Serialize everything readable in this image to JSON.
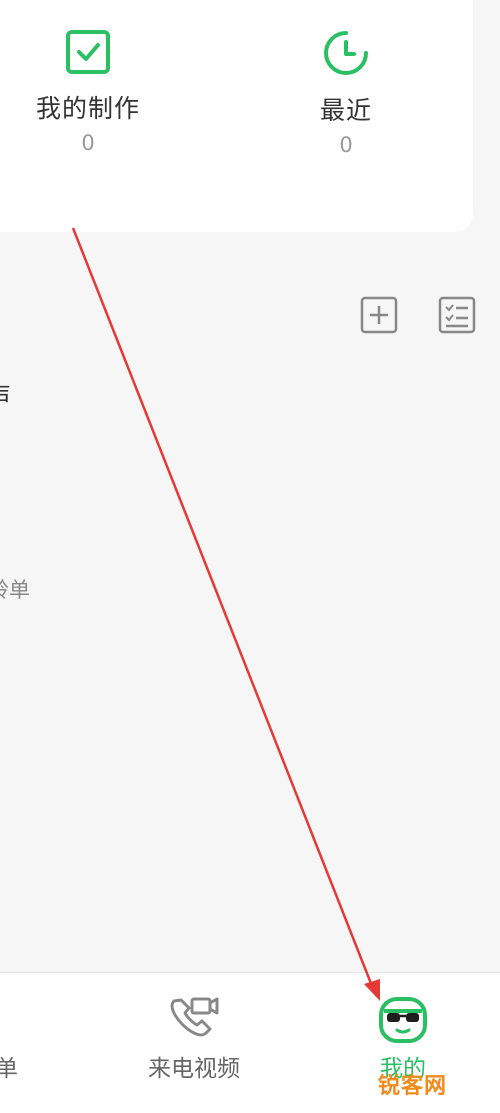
{
  "stats": [
    {
      "label": "我的制作",
      "count": "0",
      "icon": "checkbox-icon"
    },
    {
      "label": "最近",
      "count": "0",
      "icon": "clock-icon"
    }
  ],
  "toolbar": {
    "add_icon": "add-square-icon",
    "checklist_icon": "checklist-icon"
  },
  "list": {
    "title_partial": "声",
    "subtitle_partial": "铃单"
  },
  "tabbar": {
    "tabs": [
      {
        "label": "单",
        "icon": "partial-tab-icon"
      },
      {
        "label": "来电视频",
        "icon": "phone-video-icon"
      },
      {
        "label": "我的",
        "icon": "avatar-sunglasses-icon",
        "active": true
      }
    ]
  },
  "watermark": "锐客网",
  "colors": {
    "accent": "#2bbf63",
    "annotation_arrow": "#e53935",
    "watermark": "#f08a1a"
  }
}
